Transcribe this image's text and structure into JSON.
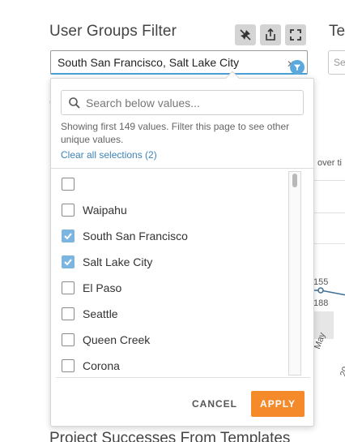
{
  "filter": {
    "title": "User Groups Filter",
    "selected_value": "South San Francisco, Salt Lake City",
    "clear_symbol": "✕",
    "toolbar": {
      "pin_icon": "pin-off-icon",
      "share_icon": "share-icon",
      "fullscreen_icon": "fullscreen-icon"
    }
  },
  "background": {
    "right_title": "Te",
    "right_search_placeholder": "Se",
    "chart_label_over_time": "over ti",
    "point_label_1": "155",
    "point_label_2": "188",
    "tick_month": "May",
    "tick_year": "20",
    "section_title": "Project Successes From Templates",
    "small_mark": "("
  },
  "dropdown": {
    "search_placeholder": "Search below values...",
    "info_text": "Showing first 149 values. Filter this page to see other unique values.",
    "clear_link": "Clear all selections (2)",
    "items": [
      {
        "label": "",
        "checked": false
      },
      {
        "label": "Waipahu",
        "checked": false
      },
      {
        "label": "South San Francisco",
        "checked": true
      },
      {
        "label": "Salt Lake City",
        "checked": true
      },
      {
        "label": "El Paso",
        "checked": false
      },
      {
        "label": "Seattle",
        "checked": false
      },
      {
        "label": "Queen Creek",
        "checked": false
      },
      {
        "label": "Corona",
        "checked": false
      }
    ],
    "cancel_label": "CANCEL",
    "apply_label": "APPLY"
  },
  "colors": {
    "accent": "#5ba8dc",
    "apply": "#f48a2a",
    "checked": "#7cb5df",
    "link": "#3d84b8"
  }
}
